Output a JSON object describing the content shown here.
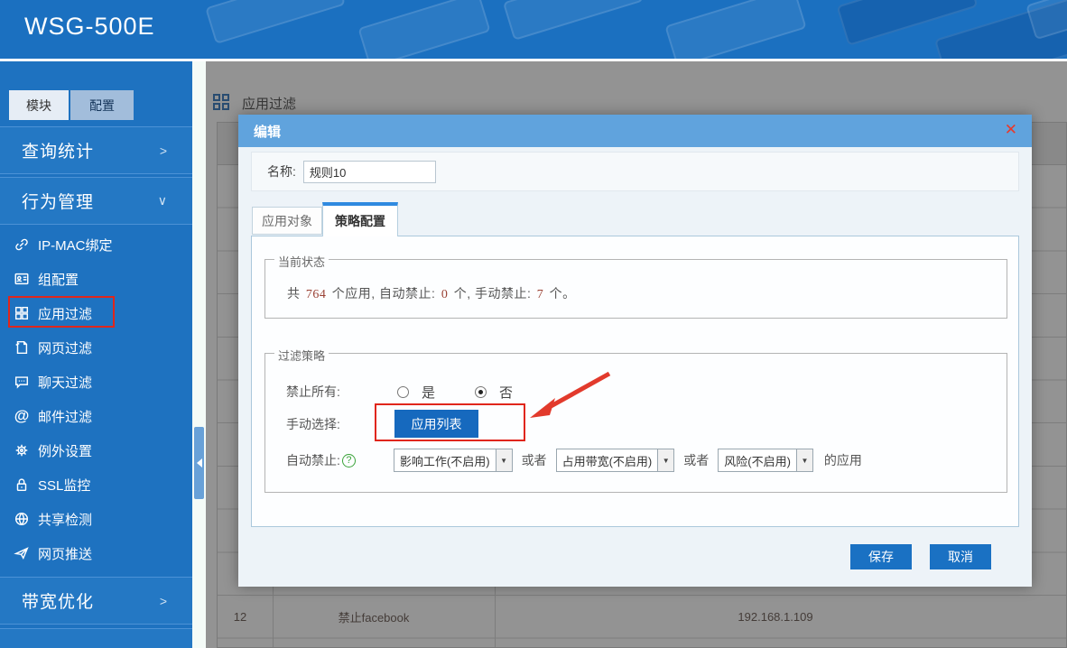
{
  "colors": {
    "header_blue": "#1b70c0",
    "sidebar_blue": "#1e72c0",
    "modal_header_blue": "#60a3dd",
    "button_blue": "#1669be",
    "annotation_red": "#e0261b",
    "active_tab_accent": "#2f8ae0"
  },
  "header": {
    "logo": "WSG-500E"
  },
  "sidebar": {
    "tabs": [
      {
        "label": "模块"
      },
      {
        "label": "配置"
      }
    ],
    "sections": [
      {
        "label": "查询统计",
        "chevron": ">"
      },
      {
        "label": "行为管理",
        "chevron": "∨"
      },
      {
        "label": "带宽优化",
        "chevron": ">"
      }
    ],
    "items": [
      {
        "label": "IP-MAC绑定",
        "icon": "link-icon"
      },
      {
        "label": "组配置",
        "icon": "id-card-icon"
      },
      {
        "label": "应用过滤",
        "icon": "grid-icon",
        "highlighted": true
      },
      {
        "label": "网页过滤",
        "icon": "webpage-icon"
      },
      {
        "label": "聊天过滤",
        "icon": "chat-icon"
      },
      {
        "label": "邮件过滤",
        "icon": "at-icon"
      },
      {
        "label": "例外设置",
        "icon": "gear-icon"
      },
      {
        "label": "SSL监控",
        "icon": "lock-icon"
      },
      {
        "label": "共享检测",
        "icon": "globe-icon"
      },
      {
        "label": "网页推送",
        "icon": "send-icon"
      }
    ],
    "at_glyph": "@"
  },
  "page": {
    "title": "应用过滤"
  },
  "background_table": {
    "visible_row": {
      "num": "12",
      "name": "禁止facebook",
      "ip": "192.168.1.109"
    }
  },
  "modal": {
    "title": "编辑",
    "close_glyph": "✕",
    "name_label": "名称:",
    "name_value": "规则10",
    "tabs": [
      {
        "label": "应用对象"
      },
      {
        "label": "策略配置",
        "active": true
      }
    ],
    "status": {
      "legend": "当前状态",
      "parts": [
        "共 ",
        "764",
        " 个应用, 自动禁止: ",
        "0",
        " 个, 手动禁止: ",
        "7",
        " 个。"
      ]
    },
    "policy": {
      "legend": "过滤策略",
      "block_all_label": "禁止所有:",
      "radio_yes": "是",
      "radio_no": "否",
      "manual_label": "手动选择:",
      "app_list_button": "应用列表",
      "auto_label": "自动禁止:",
      "help_glyph": "?",
      "selects": [
        {
          "value": "影响工作(不启用)"
        },
        {
          "value": "占用带宽(不启用)"
        },
        {
          "value": "风险(不启用)"
        }
      ],
      "or_text": "或者",
      "suffix": "的应用",
      "select_arrow": "▼"
    },
    "save_label": "保存",
    "cancel_label": "取消"
  }
}
